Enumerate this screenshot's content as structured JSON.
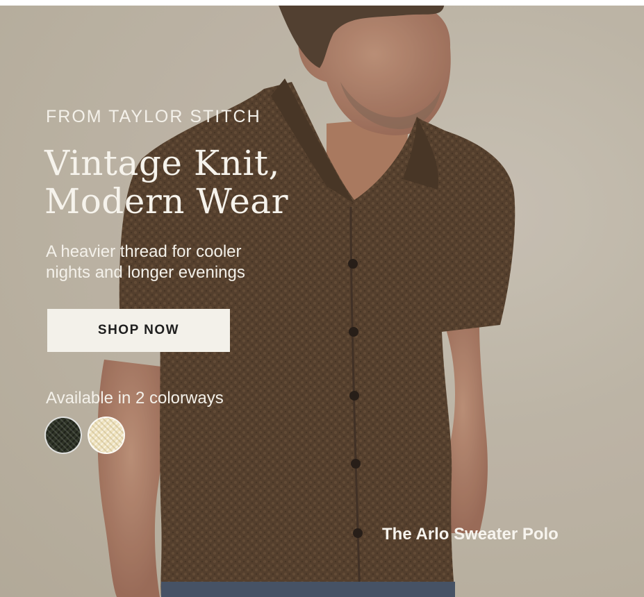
{
  "hero": {
    "eyebrow": "FROM TAYLOR STITCH",
    "headline_line1": "Vintage Knit,",
    "headline_line2": "Modern Wear",
    "subhead_line1": "A heavier thread for cooler",
    "subhead_line2": "nights and longer evenings",
    "cta_label": "SHOP NOW",
    "colorways_label": "Available in 2 colorways",
    "swatches": [
      {
        "name": "dark-olive",
        "color": "#2e3326"
      },
      {
        "name": "cream",
        "color": "#efe3bf"
      }
    ],
    "product_name": "The Arlo Sweater Polo"
  },
  "colors": {
    "background": "#cdc4b4",
    "shirt": "#5e4733",
    "cta_background": "#f3f1ea",
    "text": "#f4f1ea"
  }
}
